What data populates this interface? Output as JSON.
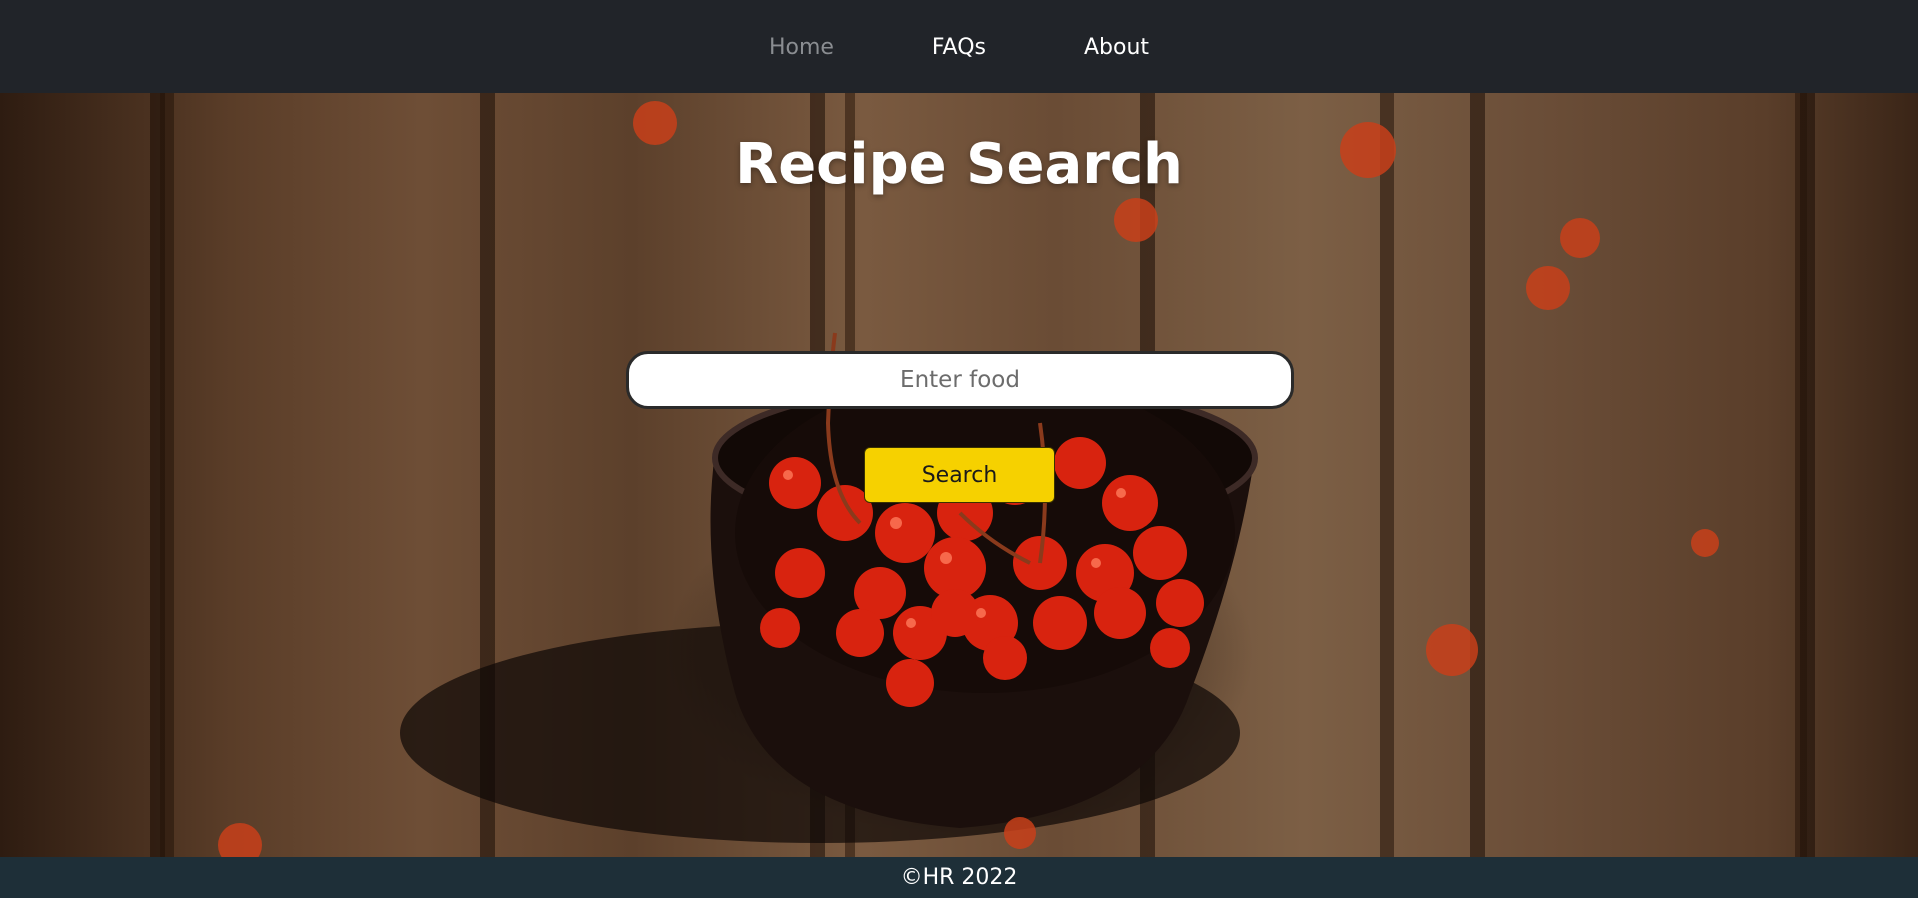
{
  "nav": {
    "items": [
      {
        "label": "Home",
        "active": true
      },
      {
        "label": "FAQs",
        "active": false
      },
      {
        "label": "About",
        "active": false
      }
    ]
  },
  "hero": {
    "title": "Recipe Search",
    "background": "wooden-table-with-bowl-of-red-berries"
  },
  "search": {
    "placeholder": "Enter food",
    "value": "",
    "button_label": "Search"
  },
  "footer": {
    "text": "©HR 2022"
  },
  "colors": {
    "navbar": "#212429",
    "nav_active": "#8a8d91",
    "button": "#f6d100",
    "footer": "#1e2f38"
  }
}
